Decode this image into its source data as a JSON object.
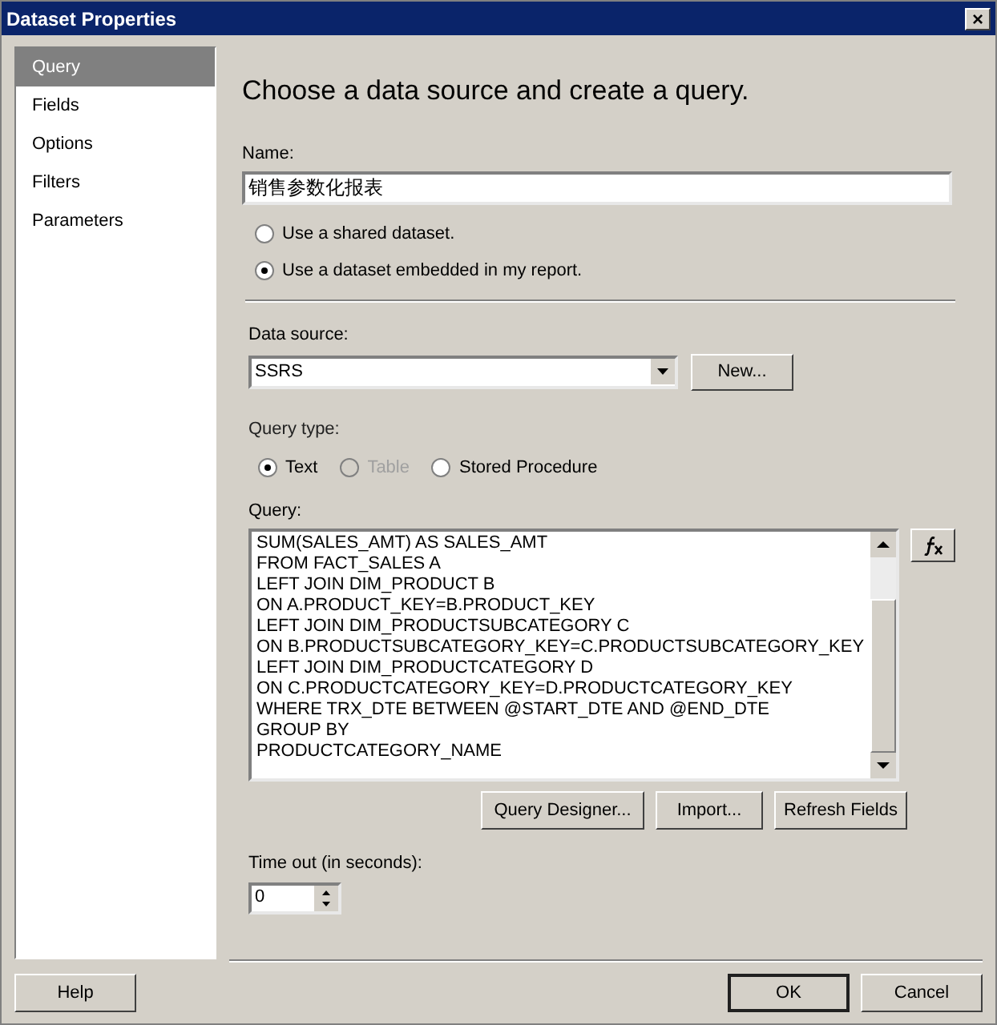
{
  "window": {
    "title": "Dataset Properties",
    "close": "×"
  },
  "sidebar": {
    "items": [
      {
        "label": "Query",
        "selected": true
      },
      {
        "label": "Fields",
        "selected": false
      },
      {
        "label": "Options",
        "selected": false
      },
      {
        "label": "Filters",
        "selected": false
      },
      {
        "label": "Parameters",
        "selected": false
      }
    ]
  },
  "heading": "Choose a data source and create a query.",
  "name": {
    "label": "Name:",
    "value": "销售参数化报表"
  },
  "dataset_source": [
    {
      "label": "Use a shared dataset.",
      "selected": false
    },
    {
      "label": "Use a dataset embedded in my report.",
      "selected": true
    }
  ],
  "data_source": {
    "label": "Data source:",
    "value": "SSRS",
    "new_button": "New..."
  },
  "query_type": {
    "label": "Query type:",
    "options": [
      {
        "label": "Text",
        "selected": true,
        "disabled": false
      },
      {
        "label": "Table",
        "selected": false,
        "disabled": true
      },
      {
        "label": "Stored Procedure",
        "selected": false,
        "disabled": false
      }
    ]
  },
  "query": {
    "label": "Query:",
    "lines": [
      "SUM(SALES_AMT) AS SALES_AMT",
      "FROM FACT_SALES A",
      "LEFT JOIN DIM_PRODUCT B",
      "ON A.PRODUCT_KEY=B.PRODUCT_KEY",
      "LEFT JOIN DIM_PRODUCTSUBCATEGORY C",
      "ON B.PRODUCTSUBCATEGORY_KEY=C.PRODUCTSUBCATEGORY_KEY",
      "LEFT JOIN DIM_PRODUCTCATEGORY D",
      "ON C.PRODUCTCATEGORY_KEY=D.PRODUCTCATEGORY_KEY",
      "WHERE TRX_DTE BETWEEN @START_DTE AND @END_DTE",
      "GROUP BY",
      "PRODUCTCATEGORY_NAME"
    ],
    "buttons": [
      "Query Designer...",
      "Import...",
      "Refresh Fields"
    ]
  },
  "timeout": {
    "label": "Time out (in seconds):",
    "value": "0"
  },
  "footer": {
    "help": "Help",
    "ok": "OK",
    "cancel": "Cancel"
  }
}
